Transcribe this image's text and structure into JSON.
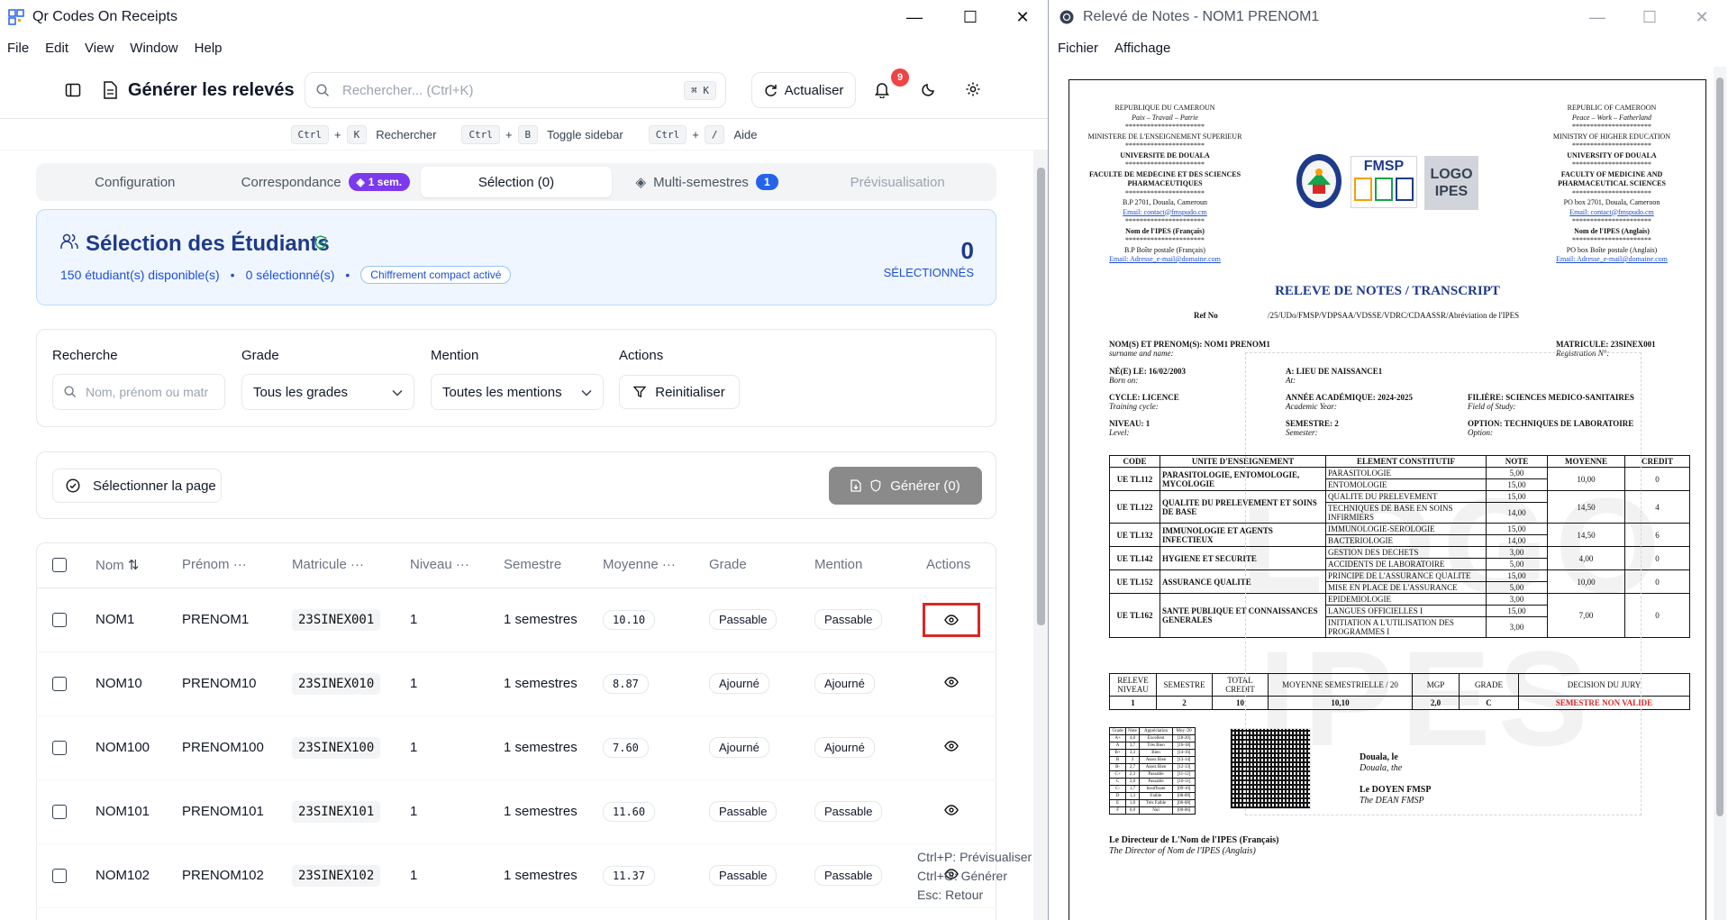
{
  "left_window": {
    "title": "Qr Codes On Receipts",
    "menu": [
      "File",
      "Edit",
      "View",
      "Window",
      "Help"
    ],
    "header": {
      "page_title": "Générer les relevés",
      "search_placeholder": "Rechercher... (Ctrl+K)",
      "search_kbd": "⌘ K",
      "refresh_label": "Actualiser",
      "notif_count": "9"
    },
    "shortcuts": [
      {
        "keys": [
          "Ctrl",
          "K"
        ],
        "label": "Rechercher"
      },
      {
        "keys": [
          "Ctrl",
          "B"
        ],
        "label": "Toggle sidebar"
      },
      {
        "keys": [
          "Ctrl",
          "/"
        ],
        "label": "Aide"
      }
    ],
    "tabs": {
      "configuration": "Configuration",
      "correspondance": "Correspondance",
      "correspondance_badge": "1 sem.",
      "selection": "Sélection (0)",
      "multi": "Multi-semestres",
      "multi_badge": "1",
      "preview": "Prévisualisation"
    },
    "selection": {
      "title": "Sélection des Étudiants",
      "available": "150 étudiant(s) disponible(s)",
      "selected": "0 sélectionné(s)",
      "compact": "Chiffrement compact activé",
      "count": "0",
      "count_label": "SÉLECTIONNÉS"
    },
    "filters": {
      "search_label": "Recherche",
      "search_placeholder": "Nom, prénom ou matr",
      "grade_label": "Grade",
      "grade_value": "Tous les grades",
      "mention_label": "Mention",
      "mention_value": "Toutes les mentions",
      "actions_label": "Actions",
      "reset_label": "Reinitialiser"
    },
    "actions": {
      "select_page": "Sélectionner la page",
      "generate": "Générer (0)"
    },
    "table": {
      "columns": [
        "Nom",
        "Prénom",
        "Matricule",
        "Niveau",
        "Semestre",
        "Moyenne",
        "Grade",
        "Mention",
        "Actions"
      ],
      "rows": [
        {
          "nom": "NOM1",
          "prenom": "PRENOM1",
          "matricule": "23SINEX001",
          "niveau": "1",
          "semestre": "1 semestres",
          "moyenne": "10.10",
          "grade": "Passable",
          "mention": "Passable"
        },
        {
          "nom": "NOM10",
          "prenom": "PRENOM10",
          "matricule": "23SINEX010",
          "niveau": "1",
          "semestre": "1 semestres",
          "moyenne": "8.87",
          "grade": "Ajourné",
          "mention": "Ajourné"
        },
        {
          "nom": "NOM100",
          "prenom": "PRENOM100",
          "matricule": "23SINEX100",
          "niveau": "1",
          "semestre": "1 semestres",
          "moyenne": "7.60",
          "grade": "Ajourné",
          "mention": "Ajourné"
        },
        {
          "nom": "NOM101",
          "prenom": "PRENOM101",
          "matricule": "23SINEX101",
          "niveau": "1",
          "semestre": "1 semestres",
          "moyenne": "11.60",
          "grade": "Passable",
          "mention": "Passable"
        },
        {
          "nom": "NOM102",
          "prenom": "PRENOM102",
          "matricule": "23SINEX102",
          "niveau": "1",
          "semestre": "1 semestres",
          "moyenne": "11.37",
          "grade": "Passable",
          "mention": "Passable"
        }
      ]
    },
    "hints": [
      "Ctrl+P: Prévisualiser",
      "Ctrl+G: Générer",
      "Esc: Retour"
    ]
  },
  "right_window": {
    "title": "Relevé de Notes - NOM1 PRENOM1",
    "menu": [
      "Fichier",
      "Affichage"
    ],
    "doc": {
      "left_header": [
        "REPUBLIQUE DU CAMEROUN",
        "Paix – Travail – Patrie",
        "**********************",
        "MINISTERE DE L'ENSEIGNEMENT SUPERIEUR",
        "**********************",
        "UNIVERSITE DE DOUALA",
        "**********************",
        "FACULTE DE MEDECINE ET DES SCIENCES",
        "PHARMACEUTIQUES",
        "**********************",
        "B.P 2701, Douala, Cameroun",
        "Email: contact@fmspudo.cm",
        "**********************",
        "Nom de l'IPES (Français)",
        "**********************",
        "B.P Boîte postale (Français)",
        "Email: Adresse_e-mail@domaine.com"
      ],
      "right_header": [
        "REPUBLIC OF CAMEROON",
        "Peace – Work – Fatherland",
        "**********************",
        "MINISTRY OF HIGHER EDUCATION",
        "**********************",
        "UNIVERSITY OF DOUALA",
        "**********************",
        "FACULTY OF MEDICINE AND",
        "PHARMACEUTICAL SCIENCES",
        "**********************",
        "PO box 2701, Douala, Cameroon",
        "Email: contact@fmspudo.cm",
        "**********************",
        "Nom de l'IPES (Anglais)",
        "**********************",
        "PO box Boîte postale (Anglais)",
        "Email: Adresse_e-mail@domaine.com"
      ],
      "fmsp_logo": "FMSP",
      "logo_ipes": [
        "LOGO",
        "IPES"
      ],
      "title": "RELEVE DE NOTES / TRANSCRIPT",
      "ref_label": "Ref No",
      "ref_value": "/25/UDo/FMSP/VDPSAA/VDSSE/VDRC/CDAASSR/Abréviation de l'IPES",
      "name_line": "NOM(S) ET PRENOM(S): NOM1 PRENOM1",
      "name_en": "surname and name:",
      "matricule": "MATRICULE: 23SINEX001",
      "matricule_en": "Registration N°:",
      "born": "NÉ(E) LE: 16/02/2003",
      "born_en": "Born on:",
      "place": "A: LIEU DE NAISSANCE1",
      "place_en": "At:",
      "cycle": "CYCLE: LICENCE",
      "cycle_en": "Training cycle:",
      "year": "ANNÉE ACADÉMIQUE: 2024-2025",
      "year_en": "Academic Year:",
      "field": "FILIÈRE: SCIENCES MEDICO-SANITAIRES",
      "field_en": "Field of Study:",
      "level": "NIVEAU: 1",
      "level_en": "Level:",
      "semester": "SEMESTRE: 2",
      "semester_en": "Semester:",
      "option": "OPTION: TECHNIQUES DE LABORATOIRE",
      "option_en": "Option:",
      "table_headers": [
        "CODE",
        "UNITE D'ENSEIGNEMENT",
        "ELEMENT CONSTITUTIF",
        "NOTE",
        "MOYENNE",
        "CREDIT"
      ],
      "units": [
        {
          "code": "UE TL112",
          "name": "PARASITOLOGIE, ENTOMOLOGIE, MYCOLOGIE",
          "elements": [
            [
              "PARASITOLOGIE",
              "5,00"
            ],
            [
              "ENTOMOLOGIE",
              "15,00"
            ]
          ],
          "avg": "10,00",
          "credit": "0"
        },
        {
          "code": "UE TL122",
          "name": "QUALITE DU PRELEVEMENT ET SOINS DE BASE",
          "elements": [
            [
              "QUALITE DU PRELEVEMENT",
              "15,00"
            ],
            [
              "TECHNIQUES DE BASE EN SOINS INFIRMIERS",
              "14,00"
            ]
          ],
          "avg": "14,50",
          "credit": "4"
        },
        {
          "code": "UE TL132",
          "name": "IMMUNOLOGIE ET AGENTS INFECTIEUX",
          "elements": [
            [
              "IMMUNOLOGIE-SEROLOGIE",
              "15,00"
            ],
            [
              "BACTERIOLOGIE",
              "14,00"
            ]
          ],
          "avg": "14,50",
          "credit": "6"
        },
        {
          "code": "UE TL142",
          "name": "HYGIENE ET SECURITE",
          "elements": [
            [
              "GESTION DES DECHETS",
              "3,00"
            ],
            [
              "ACCIDENTS DE LABORATOIRE",
              "5,00"
            ]
          ],
          "avg": "4,00",
          "credit": "0"
        },
        {
          "code": "UE TL152",
          "name": "ASSURANCE QUALITE",
          "elements": [
            [
              "PRINCIPE DE L'ASSURANCE QUALITE",
              "15,00"
            ],
            [
              "MISE EN PLACE DE L'ASSURANCE",
              "5,00"
            ]
          ],
          "avg": "10,00",
          "credit": "0"
        },
        {
          "code": "UE TL162",
          "name": "SANTE PUBLIQUE ET CONNAISSANCES GENERALES",
          "elements": [
            [
              "EPIDEMIOLOGIE",
              "3,00"
            ],
            [
              "LANGUES OFFICIELLES I",
              "15,00"
            ],
            [
              "INITIATION A L'UTILISATION DES PROGRAMMES I",
              "3,00"
            ]
          ],
          "avg": "7,00",
          "credit": "0"
        }
      ],
      "summary_headers": [
        "RELEVE NIVEAU",
        "SEMESTRE",
        "TOTAL CREDIT",
        "MOYENNE SEMESTRIELLE / 20",
        "MGP",
        "GRADE",
        "DECISION DU JURY"
      ],
      "summary_values": [
        "1",
        "2",
        "10",
        "10,10",
        "2,0",
        "C",
        "SEMESTRE NON VALIDE"
      ],
      "legend": [
        [
          "Grade",
          "Note",
          "Appréciation",
          "Moy /20"
        ],
        [
          "A+",
          "4,0",
          "Excellent",
          "[18-20]"
        ],
        [
          "A",
          "3,7",
          "Très Bien",
          "[16-18["
        ],
        [
          "B+",
          "3,3",
          "Bien",
          "[14-16["
        ],
        [
          "B",
          "3",
          "Assez Bien",
          "[13-14["
        ],
        [
          "B-",
          "2,7",
          "Assez Bien",
          "[12-13["
        ],
        [
          "C+",
          "2,3",
          "Passable",
          "[11-12["
        ],
        [
          "C",
          "2,0",
          "Passable",
          "[10-11["
        ],
        [
          "C-",
          "1,7",
          "Insuffisant",
          "[09-10["
        ],
        [
          "D",
          "1,3",
          "Faible",
          "[08-09["
        ],
        [
          "E",
          "1,0",
          "Très Faible",
          "[06-08["
        ],
        [
          "F",
          "0,0",
          "Nul",
          "[00-06["
        ]
      ],
      "douala": "Douala, le",
      "douala_en": "Douala, the",
      "dean": "Le DOYEN FMSP",
      "dean_en": "The DEAN FMSP",
      "director": "Le Directeur de L'Nom de l'IPES (Français)",
      "director_en": "The Director of Nom de l'IPES (Anglais)"
    }
  }
}
